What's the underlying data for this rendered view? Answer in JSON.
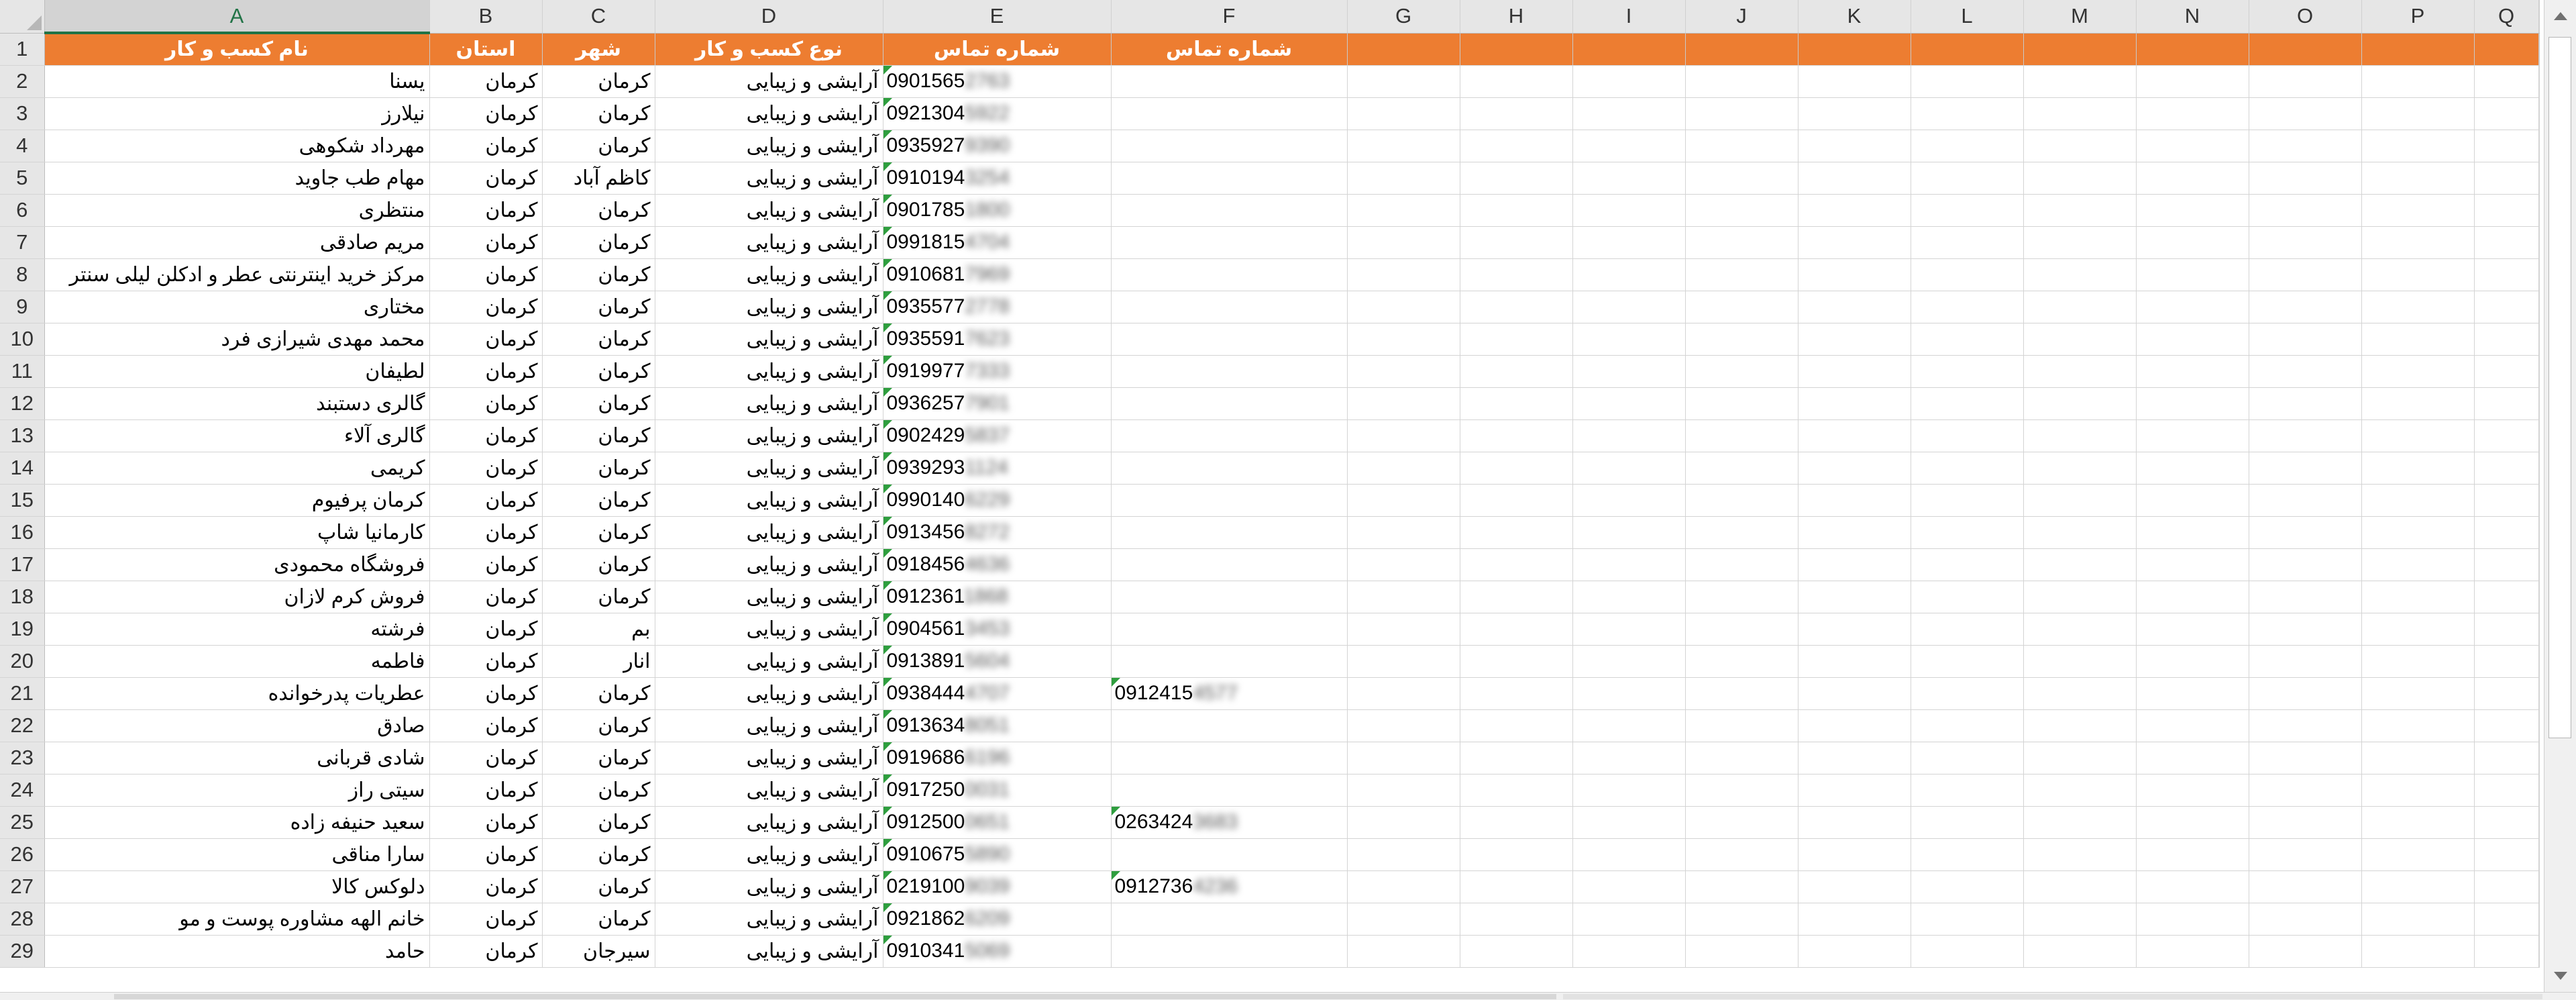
{
  "columns": [
    "A",
    "B",
    "C",
    "D",
    "E",
    "F",
    "G",
    "H",
    "I",
    "J",
    "K",
    "L",
    "M",
    "N",
    "O",
    "P",
    "Q"
  ],
  "active_column": "A",
  "headers": [
    "نام کسب و کار",
    "استان",
    "شهر",
    "نوع کسب و کار",
    "شماره تماس",
    "شماره تماس"
  ],
  "rows": [
    {
      "n": "2",
      "name": "یسنا",
      "province": "کرمان",
      "city": "کرمان",
      "type": "آرایشی و زیبایی",
      "phone": "0901565",
      "phone_hidden": "2763",
      "phone2": "",
      "phone2_hidden": ""
    },
    {
      "n": "3",
      "name": "نیلارز",
      "province": "کرمان",
      "city": "کرمان",
      "type": "آرایشی و زیبایی",
      "phone": "0921304",
      "phone_hidden": "5922",
      "phone2": "",
      "phone2_hidden": ""
    },
    {
      "n": "4",
      "name": "مهرداد شکوهی",
      "province": "کرمان",
      "city": "کرمان",
      "type": "آرایشی و زیبایی",
      "phone": "0935927",
      "phone_hidden": "9390",
      "phone2": "",
      "phone2_hidden": ""
    },
    {
      "n": "5",
      "name": "مهام طب جاوید",
      "province": "کرمان",
      "city": "کاظم آباد",
      "type": "آرایشی و زیبایی",
      "phone": "0910194",
      "phone_hidden": "3254",
      "phone2": "",
      "phone2_hidden": ""
    },
    {
      "n": "6",
      "name": "منتظری",
      "province": "کرمان",
      "city": "کرمان",
      "type": "آرایشی و زیبایی",
      "phone": "0901785",
      "phone_hidden": "1800",
      "phone2": "",
      "phone2_hidden": ""
    },
    {
      "n": "7",
      "name": "مریم صادقی",
      "province": "کرمان",
      "city": "کرمان",
      "type": "آرایشی و زیبایی",
      "phone": "0991815",
      "phone_hidden": "4704",
      "phone2": "",
      "phone2_hidden": ""
    },
    {
      "n": "8",
      "name": "مرکز خرید اینترنتی عطر و ادکلن لیلی سنتر",
      "province": "کرمان",
      "city": "کرمان",
      "type": "آرایشی و زیبایی",
      "phone": "0910681",
      "phone_hidden": "7969",
      "phone2": "",
      "phone2_hidden": ""
    },
    {
      "n": "9",
      "name": "مختاری",
      "province": "کرمان",
      "city": "کرمان",
      "type": "آرایشی و زیبایی",
      "phone": "0935577",
      "phone_hidden": "2778",
      "phone2": "",
      "phone2_hidden": ""
    },
    {
      "n": "10",
      "name": "محمد مهدی شیرازی فرد",
      "province": "کرمان",
      "city": "کرمان",
      "type": "آرایشی و زیبایی",
      "phone": "0935591",
      "phone_hidden": "7623",
      "phone2": "",
      "phone2_hidden": ""
    },
    {
      "n": "11",
      "name": "لطیفان",
      "province": "کرمان",
      "city": "کرمان",
      "type": "آرایشی و زیبایی",
      "phone": "0919977",
      "phone_hidden": "7333",
      "phone2": "",
      "phone2_hidden": ""
    },
    {
      "n": "12",
      "name": "گالری دستبند",
      "province": "کرمان",
      "city": "کرمان",
      "type": "آرایشی و زیبایی",
      "phone": "0936257",
      "phone_hidden": "7901",
      "phone2": "",
      "phone2_hidden": ""
    },
    {
      "n": "13",
      "name": "گالری آلاء",
      "province": "کرمان",
      "city": "کرمان",
      "type": "آرایشی و زیبایی",
      "phone": "0902429",
      "phone_hidden": "5837",
      "phone2": "",
      "phone2_hidden": ""
    },
    {
      "n": "14",
      "name": "کریمی",
      "province": "کرمان",
      "city": "کرمان",
      "type": "آرایشی و زیبایی",
      "phone": "0939293",
      "phone_hidden": "1124",
      "phone2": "",
      "phone2_hidden": ""
    },
    {
      "n": "15",
      "name": "کرمان پرفیوم",
      "province": "کرمان",
      "city": "کرمان",
      "type": "آرایشی و زیبایی",
      "phone": "0990140",
      "phone_hidden": "6229",
      "phone2": "",
      "phone2_hidden": ""
    },
    {
      "n": "16",
      "name": "کارمانیا شاپ",
      "province": "کرمان",
      "city": "کرمان",
      "type": "آرایشی و زیبایی",
      "phone": "0913456",
      "phone_hidden": "8272",
      "phone2": "",
      "phone2_hidden": ""
    },
    {
      "n": "17",
      "name": "فروشگاه محمودی",
      "province": "کرمان",
      "city": "کرمان",
      "type": "آرایشی و زیبایی",
      "phone": "0918456",
      "phone_hidden": "4636",
      "phone2": "",
      "phone2_hidden": ""
    },
    {
      "n": "18",
      "name": "فروش کرم لازان",
      "province": "کرمان",
      "city": "کرمان",
      "type": "آرایشی و زیبایی",
      "phone": "0912361",
      "phone_hidden": "1868",
      "phone2": "",
      "phone2_hidden": ""
    },
    {
      "n": "19",
      "name": "فرشته",
      "province": "کرمان",
      "city": "بم",
      "type": "آرایشی و زیبایی",
      "phone": "0904561",
      "phone_hidden": "3453",
      "phone2": "",
      "phone2_hidden": ""
    },
    {
      "n": "20",
      "name": "فاطمه",
      "province": "کرمان",
      "city": "انار",
      "type": "آرایشی و زیبایی",
      "phone": "0913891",
      "phone_hidden": "5604",
      "phone2": "",
      "phone2_hidden": ""
    },
    {
      "n": "21",
      "name": "عطریات پدرخوانده",
      "province": "کرمان",
      "city": "کرمان",
      "type": "آرایشی و زیبایی",
      "phone": "0938444",
      "phone_hidden": "4707",
      "phone2": "0912415",
      "phone2_hidden": "4577"
    },
    {
      "n": "22",
      "name": "صادق",
      "province": "کرمان",
      "city": "کرمان",
      "type": "آرایشی و زیبایی",
      "phone": "0913634",
      "phone_hidden": "8051",
      "phone2": "",
      "phone2_hidden": ""
    },
    {
      "n": "23",
      "name": "شادی قربانی",
      "province": "کرمان",
      "city": "کرمان",
      "type": "آرایشی و زیبایی",
      "phone": "0919686",
      "phone_hidden": "6196",
      "phone2": "",
      "phone2_hidden": ""
    },
    {
      "n": "24",
      "name": "سیتی راز",
      "province": "کرمان",
      "city": "کرمان",
      "type": "آرایشی و زیبایی",
      "phone": "0917250",
      "phone_hidden": "0031",
      "phone2": "",
      "phone2_hidden": ""
    },
    {
      "n": "25",
      "name": "سعید حنیفه زاده",
      "province": "کرمان",
      "city": "کرمان",
      "type": "آرایشی و زیبایی",
      "phone": "0912500",
      "phone_hidden": "0651",
      "phone2": "0263424",
      "phone2_hidden": "3683"
    },
    {
      "n": "26",
      "name": "سارا مناقی",
      "province": "کرمان",
      "city": "کرمان",
      "type": "آرایشی و زیبایی",
      "phone": "0910675",
      "phone_hidden": "5890",
      "phone2": "",
      "phone2_hidden": ""
    },
    {
      "n": "27",
      "name": "دلوکس کالا",
      "province": "کرمان",
      "city": "کرمان",
      "type": "آرایشی و زیبایی",
      "phone": "0219100",
      "phone_hidden": "9039",
      "phone2": "0912736",
      "phone2_hidden": "4236"
    },
    {
      "n": "28",
      "name": "خانم الهه مشاوره پوست و مو",
      "province": "کرمان",
      "city": "کرمان",
      "type": "آرایشی و زیبایی",
      "phone": "0921862",
      "phone_hidden": "6209",
      "phone2": "",
      "phone2_hidden": ""
    },
    {
      "n": "29",
      "name": "حامد",
      "province": "کرمان",
      "city": "سیرجان",
      "type": "آرایشی و زیبایی",
      "phone": "0910341",
      "phone_hidden": "5069",
      "phone2": "",
      "phone2_hidden": ""
    }
  ],
  "colors": {
    "header_fill": "#ed7d31",
    "header_text": "#ffffff",
    "active_column": "#217346",
    "flag": "#2e9e3e"
  }
}
